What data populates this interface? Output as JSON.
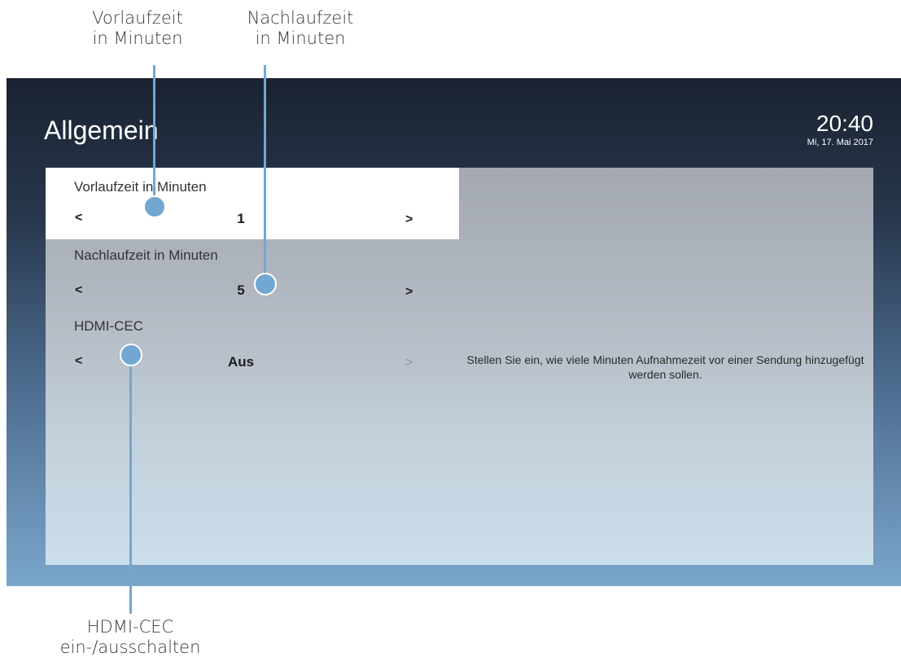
{
  "annotations": {
    "lead_time": [
      "Vorlaufzeit",
      "in Minuten"
    ],
    "follow_time": [
      "Nachlaufzeit",
      "in Minuten"
    ],
    "hdmi_cec": [
      "HDMI-CEC",
      "ein-/ausschalten"
    ]
  },
  "header": {
    "title": "Allgemein",
    "time": "20:40",
    "date": "Mi, 17. Mai 2017"
  },
  "settings": [
    {
      "label": "Vorlaufzeit in Minuten",
      "prev": "<",
      "value": "1",
      "next": ">",
      "selected": true
    },
    {
      "label": "Nachlaufzeit in Minuten",
      "prev": "<",
      "value": "5",
      "next": ">",
      "selected": false
    },
    {
      "label": "HDMI-CEC",
      "prev": "<",
      "value": "Aus",
      "next": ">",
      "selected": false
    }
  ],
  "description": "Stellen Sie ein, wie viele Minuten Aufnahmezeit vor einer Sendung hinzugefügt werden sollen.",
  "colors": {
    "accent": "#72a7d2",
    "selected_row": "#ffffff",
    "background_top": "#1a2230",
    "background_bottom": "#7aa6cb"
  }
}
